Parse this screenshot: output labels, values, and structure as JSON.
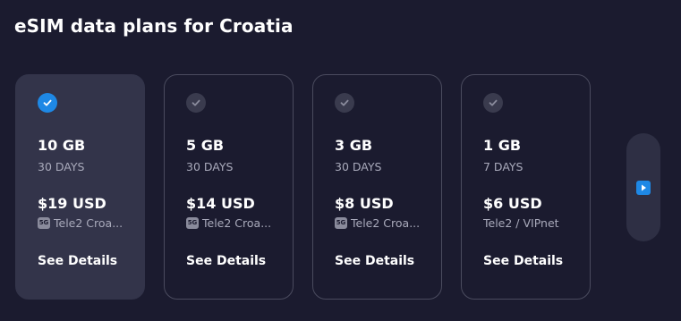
{
  "page": {
    "title": "eSIM data plans for Croatia"
  },
  "colors": {
    "background": "#1b1b2f",
    "selected_card": "#33344a",
    "accent": "#1e88e5",
    "muted_text": "#a9aabb"
  },
  "plans": [
    {
      "size": "10 GB",
      "days": "30 DAYS",
      "price": "$19 USD",
      "badge": "5G",
      "carrier": "Tele2 Croa...",
      "details_label": "See Details",
      "selected": true,
      "icon": "check-circle-icon"
    },
    {
      "size": "5 GB",
      "days": "30 DAYS",
      "price": "$14 USD",
      "badge": "5G",
      "carrier": "Tele2 Croa...",
      "details_label": "See Details",
      "selected": false,
      "icon": "check-circle-icon"
    },
    {
      "size": "3 GB",
      "days": "30 DAYS",
      "price": "$8 USD",
      "badge": "5G",
      "carrier": "Tele2 Croa...",
      "details_label": "See Details",
      "selected": false,
      "icon": "check-circle-icon"
    },
    {
      "size": "1 GB",
      "days": "7 DAYS",
      "price": "$6 USD",
      "carrier": "Tele2 / VIPnet",
      "details_label": "See Details",
      "selected": false,
      "icon": "check-circle-icon"
    }
  ],
  "navigation": {
    "next_icon": "next-arrow-icon"
  }
}
